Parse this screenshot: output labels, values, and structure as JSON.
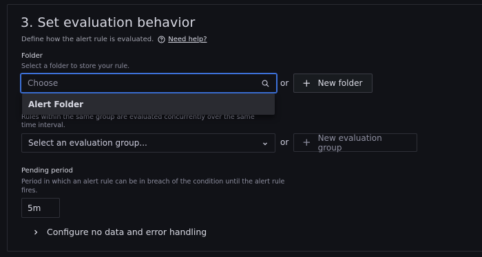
{
  "section": {
    "title": "3. Set evaluation behavior",
    "description": "Define how the alert rule is evaluated.",
    "help_link": "Need help?"
  },
  "folder": {
    "label": "Folder",
    "sublabel": "Select a folder to store your rule.",
    "placeholder": "Choose",
    "or": "or",
    "new_button": "New folder",
    "options": [
      "Alert Folder"
    ]
  },
  "evaluation_group": {
    "sublabel_line1": "Rules within the same group are evaluated concurrently over the same",
    "sublabel_line2": "time interval.",
    "placeholder": "Select an evaluation group...",
    "or": "or",
    "new_button": "New evaluation group"
  },
  "pending": {
    "label": "Pending period",
    "sublabel_line1": "Period in which an alert rule can be in breach of the condition until the alert rule",
    "sublabel_line2": "fires.",
    "value": "5m"
  },
  "config": {
    "label": "Configure no data and error handling"
  },
  "colors": {
    "background": "#111217",
    "focus_border": "#3d71d9",
    "dropdown_bg": "#2a2b31"
  }
}
